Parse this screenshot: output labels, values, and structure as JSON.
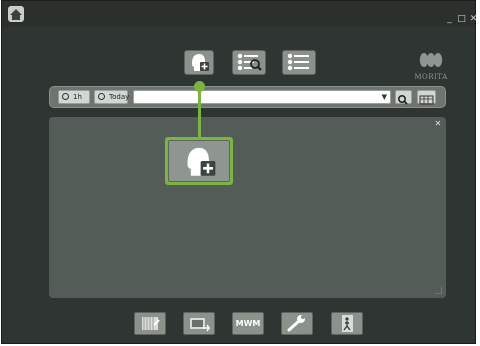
{
  "window": {
    "minimize_glyph": "_",
    "maximize_glyph": "□",
    "close_glyph": "✕"
  },
  "logo": {
    "text": "MORITA"
  },
  "toolbar": {
    "buttons": [
      {
        "icon": "new-patient-icon"
      },
      {
        "icon": "patient-search-icon"
      },
      {
        "icon": "patient-list-icon"
      }
    ]
  },
  "search": {
    "filter_1h": "1h",
    "filter_today": "Today",
    "value": "",
    "dropdown_glyph": "▼"
  },
  "panel": {
    "close_glyph": "✕"
  },
  "highlight_color": "#7cb342",
  "footer": {
    "mwm_label": "MWM"
  }
}
